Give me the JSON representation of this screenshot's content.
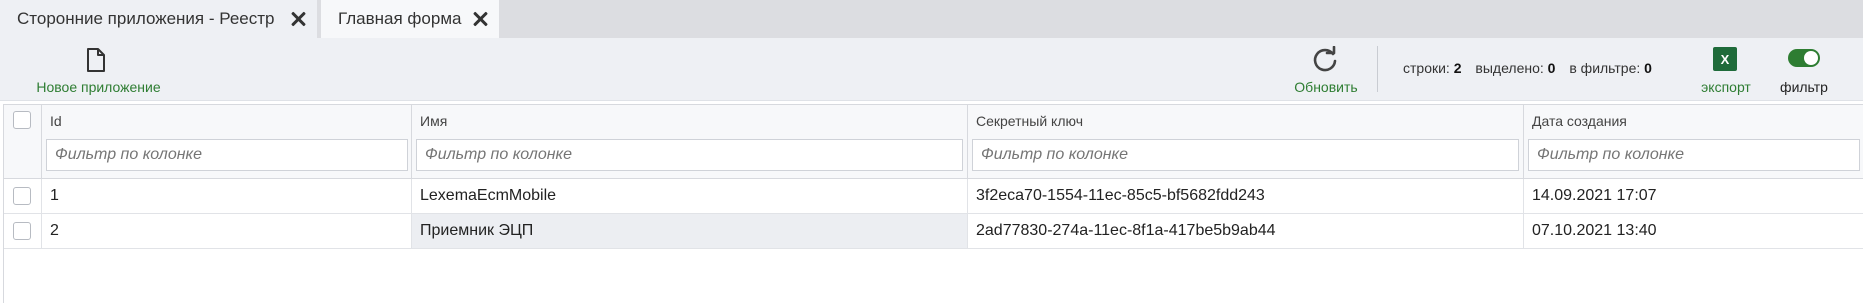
{
  "tabs": [
    {
      "label": "Сторонние приложения - Реестр"
    },
    {
      "label": "Главная форма"
    }
  ],
  "toolbar": {
    "new_app_label": "Новое приложение",
    "refresh_label": "Обновить",
    "stats": {
      "rows_label": "строки:",
      "rows_value": "2",
      "selected_label": "выделено:",
      "selected_value": "0",
      "filtered_label": "в фильтре:",
      "filtered_value": "0"
    },
    "export_label": "экспорт",
    "export_icon_text": "X",
    "filter_label": "фильтр",
    "filter_enabled": true
  },
  "grid": {
    "columns": [
      {
        "title": "Id",
        "filter_placeholder": "Фильтр по колонке"
      },
      {
        "title": "Имя",
        "filter_placeholder": "Фильтр по колонке"
      },
      {
        "title": "Секретный ключ",
        "filter_placeholder": "Фильтр по колонке"
      },
      {
        "title": "Дата создания",
        "filter_placeholder": "Фильтр по колонке"
      }
    ],
    "rows": [
      {
        "id": "1",
        "name": "LexemaEcmMobile",
        "key": "3f2eca70-1554-11ec-85c5-bf5682fdd243",
        "date": "14.09.2021 17:07"
      },
      {
        "id": "2",
        "name": "Приемник ЭЦП",
        "key": "2ad77830-274a-11ec-8f1a-417be5b9ab44",
        "date": "07.10.2021 13:40"
      }
    ]
  },
  "colors": {
    "accent_green": "#2e7d32",
    "excel_green": "#1f6b3a",
    "toolbar_bg": "#eef0f4"
  }
}
